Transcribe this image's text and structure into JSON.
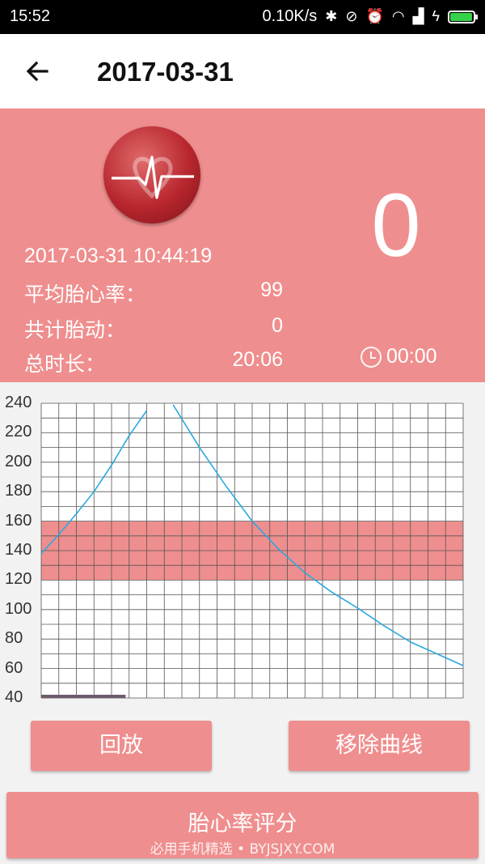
{
  "status_bar": {
    "time": "15:52",
    "network_speed": "0.10K/s",
    "icons": [
      "bluetooth-icon",
      "vibrate-off-icon",
      "alarm-icon",
      "wifi-icon",
      "signal-icon",
      "charging-icon",
      "battery-icon"
    ],
    "battery_level_fraction": 0.95
  },
  "header": {
    "title": "2017-03-31"
  },
  "summary": {
    "datetime": "2017-03-31 10:44:19",
    "avg_label": "平均胎心率：",
    "avg_value": "99",
    "movements_label": "共计胎动：",
    "movements_value": "0",
    "duration_label": "总时长：",
    "duration_value": "20:06",
    "big_count": "0",
    "timer": "00:00"
  },
  "chart_data": {
    "type": "line",
    "title": "",
    "xlabel": "",
    "ylabel": "",
    "ylim": [
      40,
      240
    ],
    "yticks": [
      "240",
      "220",
      "200",
      "180",
      "160",
      "140",
      "120",
      "100",
      "80",
      "60",
      "40"
    ],
    "normal_band": [
      120,
      160
    ],
    "grid": true,
    "series": [
      {
        "color": "#29a9e0",
        "segments": [
          {
            "x": [
              0,
              1,
              2,
              3,
              4,
              5,
              6
            ],
            "y": [
              138,
              151,
              165,
              180,
              198,
              218,
              235
            ]
          },
          {
            "x": [
              7.5,
              9,
              10.5,
              12,
              13.5,
              15,
              16.5,
              18,
              19.5,
              21,
              22.5,
              24
            ],
            "y": [
              239,
              210,
              184,
              160,
              141,
              125,
              112,
              101,
              89,
              78,
              70,
              62
            ]
          }
        ]
      }
    ],
    "x_progress_fraction": 0.2
  },
  "colors": {
    "accent": "#ef8e8e",
    "band": "#ef8e8e",
    "line": "#29a9e0",
    "progress": "#6b5b6b"
  },
  "buttons": {
    "replay": "回放",
    "remove_curve": "移除曲线",
    "score": "胎心率评分"
  },
  "watermark": "必用手机精选 • BYJSJXY.COM"
}
